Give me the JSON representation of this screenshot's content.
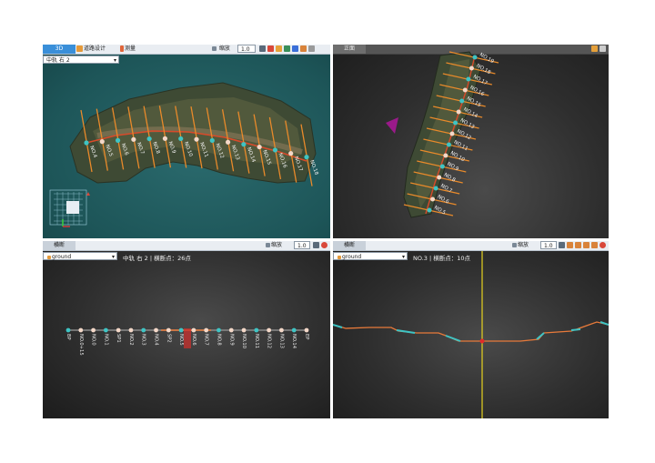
{
  "tl": {
    "tabs": [
      "3D",
      "道路设计",
      "测量"
    ],
    "dropdown": "中轨 右 2",
    "scale_label": "缩放",
    "scale_value": "1.0",
    "stations": [
      "NO.4",
      "NO.5",
      "NO.6",
      "NO.7",
      "NO.8",
      "NO.9",
      "NO.10",
      "NO.11",
      "NO.12",
      "NO.13",
      "NO.14",
      "NO.15",
      "NO.16",
      "NO.17",
      "NO.18"
    ]
  },
  "tr": {
    "title": "正面",
    "stations": [
      "NO.19",
      "NO.18",
      "NO.17",
      "NO.16",
      "NO.15",
      "NO.14",
      "NO.13",
      "NO.12",
      "NO.11",
      "NO.10",
      "NO.9",
      "NO.8",
      "NO.7",
      "NO.6",
      "NO.5"
    ]
  },
  "bl": {
    "title": "横断",
    "scale_label": "缩放",
    "scale_value": "1.0",
    "layer": "ground",
    "caption": "中轨 右 2 | 横断点：26点",
    "stations": [
      "BP",
      "NO.0+15",
      "NO.0",
      "NO.1",
      "SP1",
      "NO.2",
      "NO.3",
      "NO.4",
      "SP2",
      "NO.5",
      "NO.6",
      "NO.7",
      "NO.8",
      "NO.9",
      "NO.10",
      "NO.11",
      "NO.12",
      "NO.13",
      "NO.14",
      "EP"
    ]
  },
  "br": {
    "title": "横断",
    "scale_label": "缩放",
    "scale_value": "1.0",
    "layer": "ground",
    "caption": "NO.3 | 横断点：10点"
  },
  "colors": {
    "teal_bg": "#1f5a5e",
    "dark_bg": "#2e2e2e",
    "station": "#e98a2a",
    "vertex": "#3ec4c4",
    "profile": "#e87a3a"
  }
}
